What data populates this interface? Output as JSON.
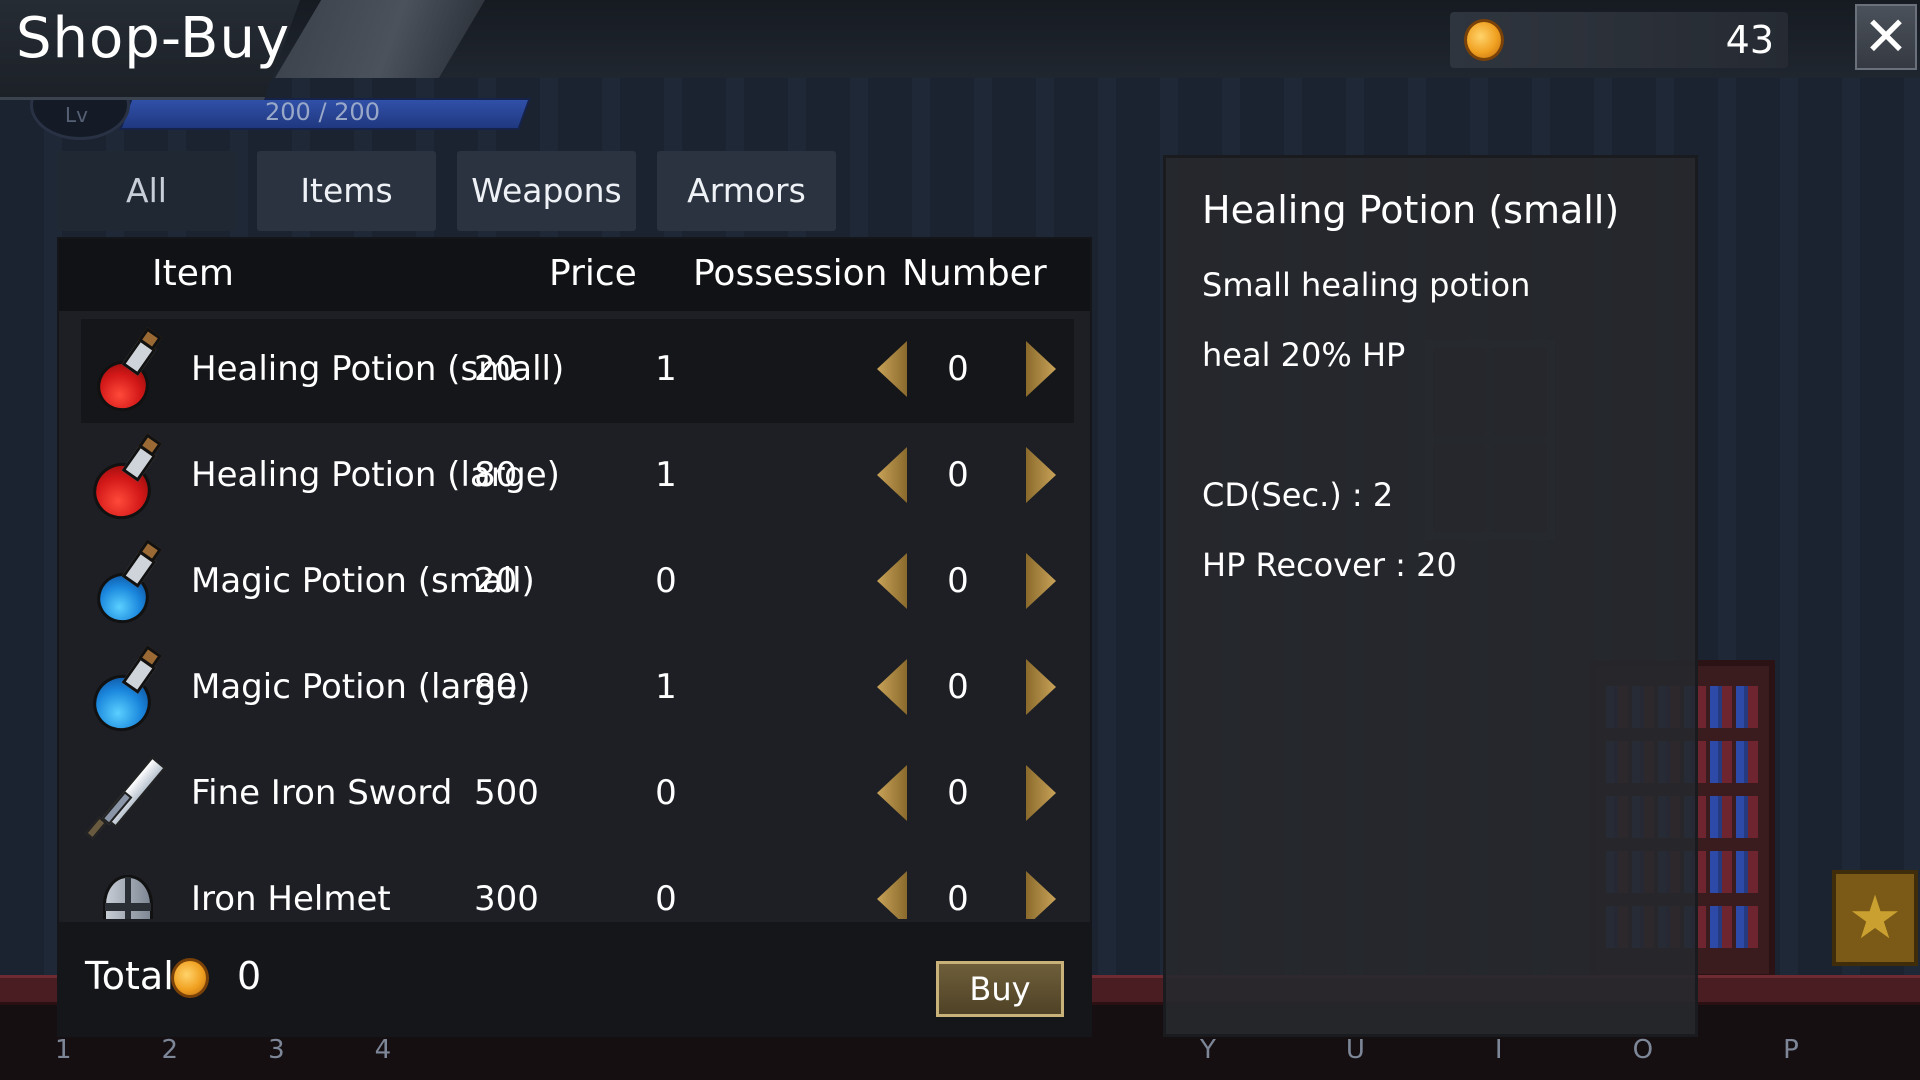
{
  "topbar": {
    "title": "Shop-Buy",
    "gold_icon": "gold-coin-icon",
    "gold_amount": "43",
    "close_icon": "close-icon"
  },
  "hud": {
    "level_label": "Lv",
    "hp_text": "200 / 200"
  },
  "tabs": [
    {
      "label": "All",
      "active": true
    },
    {
      "label": "Items",
      "active": false
    },
    {
      "label": "Weapons",
      "active": false
    },
    {
      "label": "Armors",
      "active": false
    }
  ],
  "list": {
    "headers": {
      "item": "Item",
      "price": "Price",
      "possession": "Possession",
      "number": "Number"
    },
    "rows": [
      {
        "icon": "red-potion-small-icon",
        "name": "Healing Potion (small)",
        "price": "20",
        "possession": "1",
        "number": "0",
        "selected": true
      },
      {
        "icon": "red-potion-large-icon",
        "name": "Healing Potion (large)",
        "price": "80",
        "possession": "1",
        "number": "0",
        "selected": false
      },
      {
        "icon": "blue-potion-small-icon",
        "name": "Magic Potion (small)",
        "price": "20",
        "possession": "0",
        "number": "0",
        "selected": false
      },
      {
        "icon": "blue-potion-large-icon",
        "name": "Magic Potion (large)",
        "price": "80",
        "possession": "1",
        "number": "0",
        "selected": false
      },
      {
        "icon": "sword-icon",
        "name": "Fine Iron Sword",
        "price": "500",
        "possession": "0",
        "number": "0",
        "selected": false
      },
      {
        "icon": "helmet-icon",
        "name": "Iron Helmet",
        "price": "300",
        "possession": "0",
        "number": "0",
        "selected": false
      }
    ]
  },
  "footer": {
    "total_label": "Total",
    "total_value": "0",
    "buy_label": "Buy"
  },
  "detail": {
    "title": "Healing Potion (small)",
    "lines": [
      "Small healing potion",
      "heal 20% HP",
      "CD(Sec.) : 2",
      "HP Recover : 20"
    ]
  },
  "hotbar": {
    "slots": [
      "1",
      "2",
      "3",
      "4"
    ],
    "keys": [
      "Y",
      "U",
      "I",
      "O",
      "P"
    ]
  },
  "colors": {
    "gold": "#f0a020",
    "arrow": "#c8a258",
    "buy_border": "#c9b27a",
    "panel": "#1e1f24"
  }
}
